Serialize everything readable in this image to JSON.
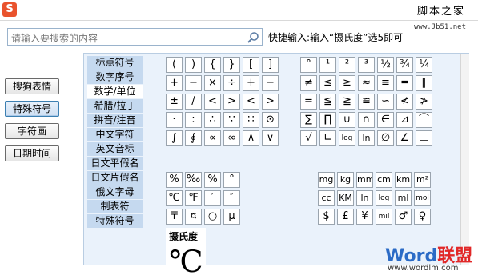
{
  "app": {
    "logo": "S",
    "brand_text": "脚本之家",
    "site": "www.Jb51.net"
  },
  "search": {
    "placeholder": "请输入要搜索的内容"
  },
  "hint": "快捷输入:输入“摄氏度”选5即可",
  "side_buttons": [
    {
      "label": "搜狗表情",
      "active": false
    },
    {
      "label": "特殊符号",
      "active": true
    },
    {
      "label": "字符画",
      "active": false
    },
    {
      "label": "日期时间",
      "active": false
    }
  ],
  "categories": [
    {
      "label": "标点符号",
      "selected": false
    },
    {
      "label": "数字序号",
      "selected": false
    },
    {
      "label": "数学/单位",
      "selected": true
    },
    {
      "label": "希腊/拉丁",
      "selected": false
    },
    {
      "label": "拼音/注音",
      "selected": false
    },
    {
      "label": "中文字符",
      "selected": false
    },
    {
      "label": "英文音标",
      "selected": false
    },
    {
      "label": "日文平假名",
      "selected": false
    },
    {
      "label": "日文片假名",
      "selected": false
    },
    {
      "label": "俄文字母",
      "selected": false
    },
    {
      "label": "制表符",
      "selected": false
    },
    {
      "label": "特殊符号",
      "selected": false
    }
  ],
  "grids": {
    "math_brackets_ops": [
      "(",
      ")",
      "{",
      "}",
      "[",
      "]",
      "+",
      "−",
      "×",
      "÷",
      "+",
      "−",
      "±",
      "/",
      "<",
      ">",
      "<",
      ">",
      "·",
      ":",
      "∴",
      "∵",
      "∷",
      "⊙",
      "∫",
      "∮",
      "∝",
      "∞",
      "∧",
      "∨"
    ],
    "math_relations": [
      "°",
      "¹",
      "²",
      "³",
      "½",
      "¾",
      "¼",
      "≠",
      "≤",
      "≥",
      "≈",
      "≡",
      "═",
      "∥",
      "=",
      "≦",
      "≧",
      "≌",
      "∽",
      "≮",
      "≯",
      "∑",
      "∏",
      "∪",
      "∩",
      "∈",
      "⊿",
      "⌒",
      "√",
      "∟",
      "log",
      "ln",
      "∅",
      "∠",
      "⊥"
    ],
    "units_temp": [
      "%",
      "‰",
      "%",
      "°",
      "℃",
      "℉",
      "′",
      "″",
      "〒",
      "¤",
      "○",
      "μ"
    ],
    "units_measure": [
      "mg",
      "kg",
      "mm",
      "cm",
      "km",
      "m²",
      "cc",
      "KM",
      "ln",
      "log",
      "ml",
      "mol",
      "$",
      "£",
      "¥",
      "mil",
      "♂",
      "♀"
    ]
  },
  "preview": {
    "name": "摄氏度",
    "glyph": "℃"
  },
  "watermark": {
    "en": "Word",
    "cn": "联盟",
    "url": "www.wordlm.com"
  }
}
